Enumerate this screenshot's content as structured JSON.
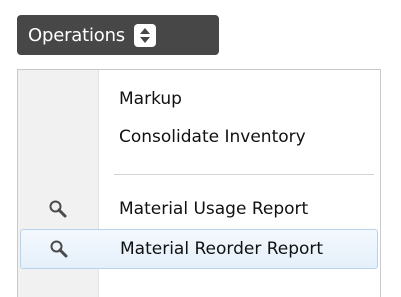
{
  "operations_button": {
    "label": "Operations",
    "icon": "updown-spinner-icon"
  },
  "menu": {
    "items": [
      {
        "label": "Markup",
        "icon": null
      },
      {
        "label": "Consolidate Inventory",
        "icon": null
      },
      {
        "label": "Material Usage Report",
        "icon": "magnifier-icon"
      },
      {
        "label": "Material Reorder Report",
        "icon": "magnifier-icon",
        "highlighted": true
      }
    ]
  },
  "colors": {
    "button_bg": "#474747",
    "highlight_bg": "#e5f0fa",
    "highlight_border": "#b9d3ee",
    "gutter_bg": "#f1f1f1"
  }
}
